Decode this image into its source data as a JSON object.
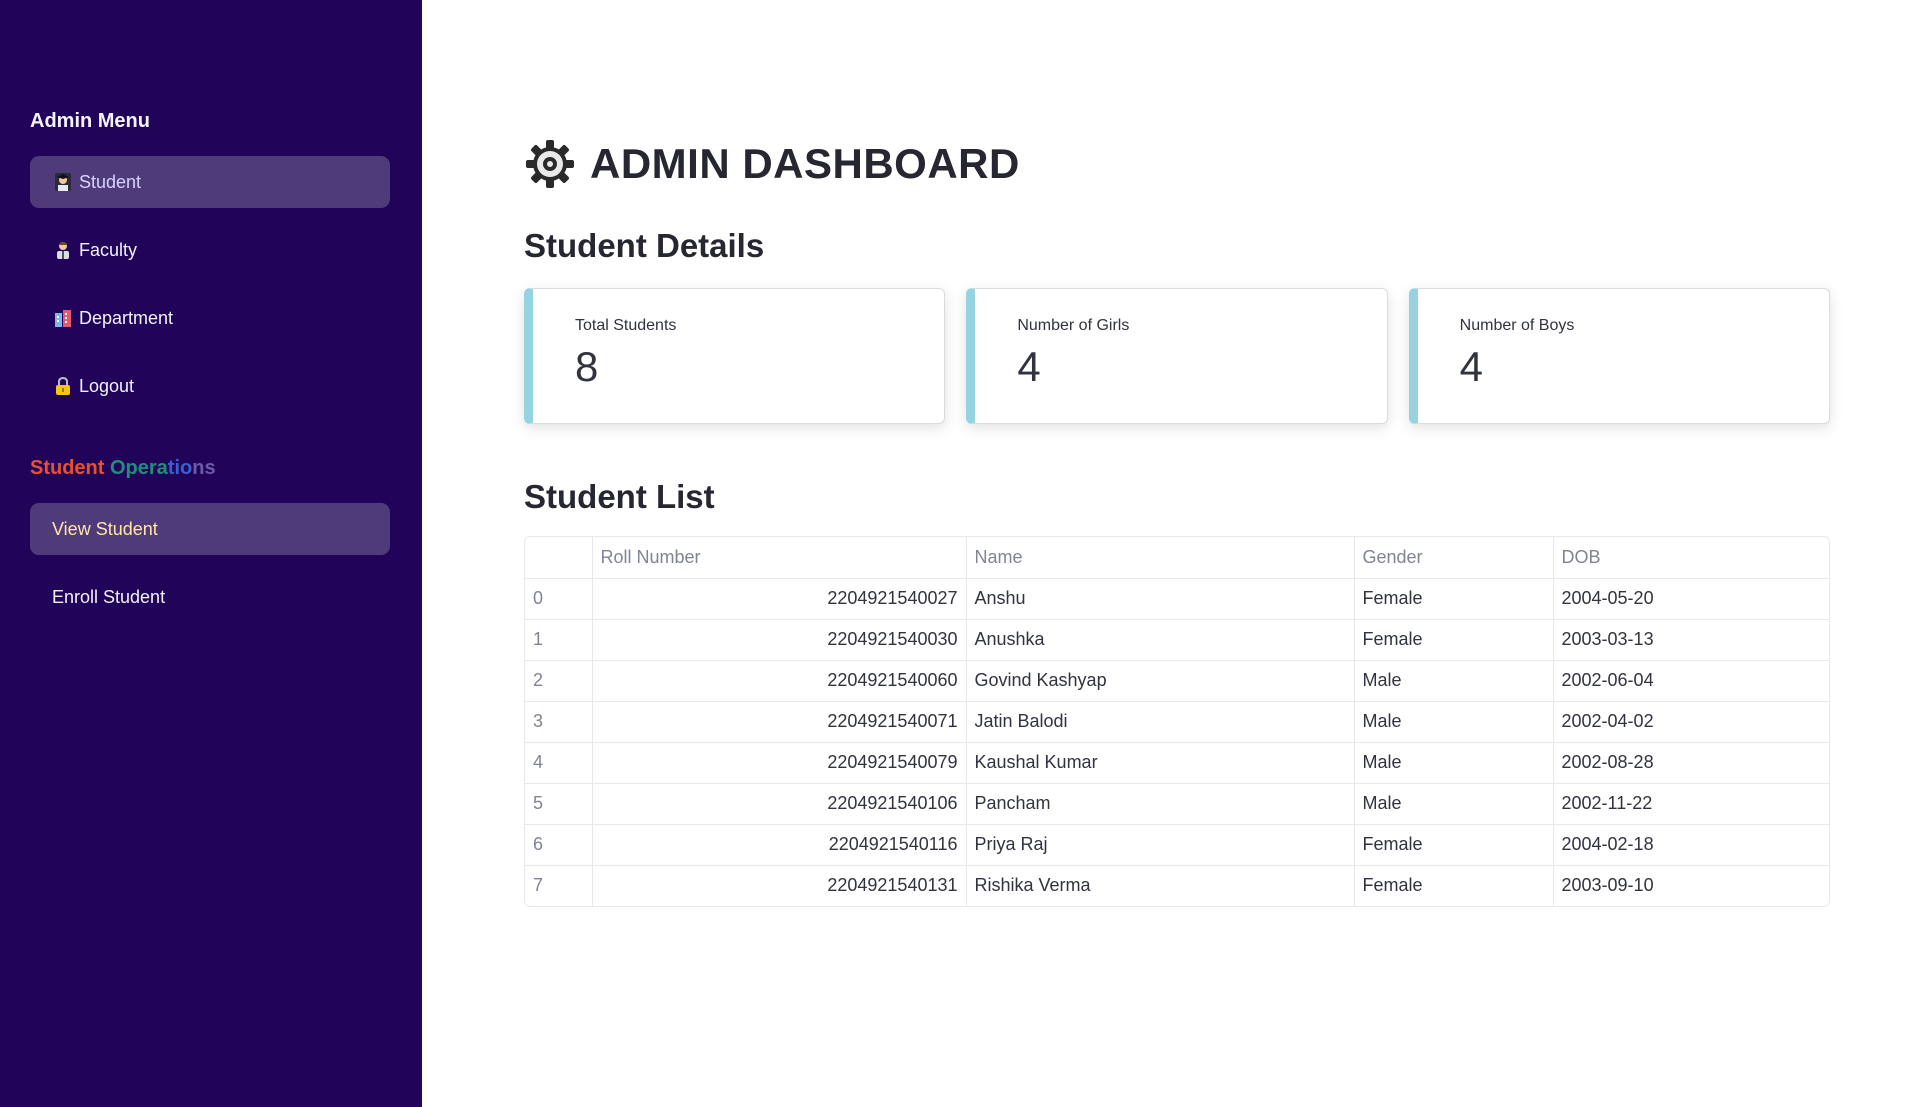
{
  "sidebar": {
    "menu_heading": "Admin Menu",
    "menu_items": [
      {
        "label": "Student",
        "icon": "student-icon",
        "selected": true
      },
      {
        "label": "Faculty",
        "icon": "teacher-icon",
        "selected": false
      },
      {
        "label": "Department",
        "icon": "building-icon",
        "selected": false
      },
      {
        "label": "Logout",
        "icon": "lock-icon",
        "selected": false
      }
    ],
    "ops_heading_parts": [
      "Student",
      " Opera",
      "tio",
      "ns"
    ],
    "ops_items": [
      {
        "label": "View Student",
        "selected": true
      },
      {
        "label": "Enroll Student",
        "selected": false
      }
    ]
  },
  "main": {
    "title": "ADMIN DASHBOARD",
    "title_icon": "gear-icon",
    "details_heading": "Student Details",
    "metrics": [
      {
        "label": "Total Students",
        "value": "8"
      },
      {
        "label": "Number of Girls",
        "value": "4"
      },
      {
        "label": "Number of Boys",
        "value": "4"
      }
    ],
    "list_heading": "Student List",
    "table": {
      "columns": [
        "",
        "Roll Number",
        "Name",
        "Gender",
        "DOB"
      ],
      "rows": [
        [
          "0",
          "2204921540027",
          "Anshu",
          "Female",
          "2004-05-20"
        ],
        [
          "1",
          "2204921540030",
          "Anushka",
          "Female",
          "2003-03-13"
        ],
        [
          "2",
          "2204921540060",
          "Govind Kashyap",
          "Male",
          "2002-06-04"
        ],
        [
          "3",
          "2204921540071",
          "Jatin Balodi",
          "Male",
          "2002-04-02"
        ],
        [
          "4",
          "2204921540079",
          "Kaushal Kumar",
          "Male",
          "2002-08-28"
        ],
        [
          "5",
          "2204921540106",
          "Pancham",
          "Male",
          "2002-11-22"
        ],
        [
          "6",
          "2204921540116",
          "Priya Raj",
          "Female",
          "2004-02-18"
        ],
        [
          "7",
          "2204921540131",
          "Rishika Verma",
          "Female",
          "2003-09-10"
        ]
      ]
    }
  },
  "colors": {
    "sidebar_bg": "#21045a",
    "nav_selected_bg": "#4f3b79",
    "metric_accent": "#95d3e0"
  }
}
